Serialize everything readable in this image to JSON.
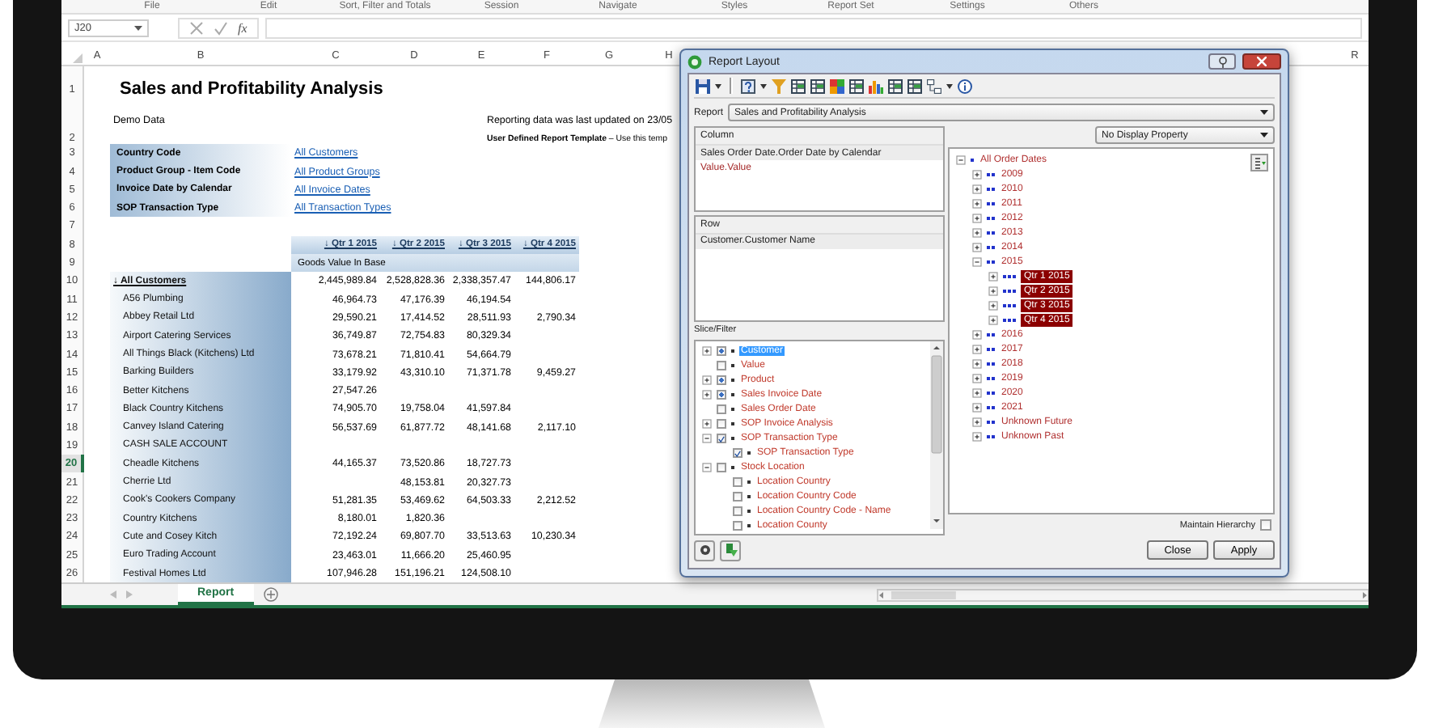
{
  "ribbon": {
    "groups": [
      "File",
      "Edit",
      "Sort, Filter and Totals",
      "Session",
      "Navigate",
      "Styles",
      "Report Set",
      "Settings",
      "Others"
    ]
  },
  "formula_bar": {
    "name_box": "J20",
    "function_label": "fx"
  },
  "sheet": {
    "columns": [
      "A",
      "B",
      "C",
      "D",
      "E",
      "F",
      "G",
      "H",
      "R"
    ],
    "row_headers": [
      {
        "label": "1",
        "selected": false
      },
      {
        "label": "2",
        "selected": false
      },
      {
        "label": "3",
        "selected": false
      },
      {
        "label": "4",
        "selected": false
      },
      {
        "label": "5",
        "selected": false
      },
      {
        "label": "6",
        "selected": false
      },
      {
        "label": "7",
        "selected": false
      },
      {
        "label": "8",
        "selected": false
      },
      {
        "label": "9",
        "selected": false
      },
      {
        "label": "10",
        "selected": false
      },
      {
        "label": "11",
        "selected": false
      },
      {
        "label": "12",
        "selected": false
      },
      {
        "label": "13",
        "selected": false
      },
      {
        "label": "14",
        "selected": false
      },
      {
        "label": "15",
        "selected": false
      },
      {
        "label": "16",
        "selected": false
      },
      {
        "label": "17",
        "selected": false
      },
      {
        "label": "18",
        "selected": false
      },
      {
        "label": "19",
        "selected": false
      },
      {
        "label": "20",
        "selected": true
      },
      {
        "label": "21",
        "selected": false
      },
      {
        "label": "22",
        "selected": false
      },
      {
        "label": "23",
        "selected": false
      },
      {
        "label": "24",
        "selected": false
      },
      {
        "label": "25",
        "selected": false
      },
      {
        "label": "26",
        "selected": false
      }
    ],
    "title": "Sales and Profitability Analysis",
    "subtitle": "Demo Data",
    "update_note": "Reporting data was last updated on 23/05",
    "template_note": "**User Defined Report Template** – Use this temp",
    "filters": [
      {
        "label": "Country Code",
        "link": "All Customers"
      },
      {
        "label": "Product Group - Item Code",
        "link": "All Product Groups"
      },
      {
        "label": "Invoice Date by Calendar",
        "link": "All Invoice Dates"
      },
      {
        "label": "SOP Transaction Type",
        "link": "All Transaction Types"
      }
    ],
    "periods": [
      "↓ Qtr 1 2015",
      "↓ Qtr 2 2015",
      "↓ Qtr 3 2015",
      "↓ Qtr 4 2015"
    ],
    "measure": "Goods Value In Base",
    "total": {
      "label": "↓ All Customers",
      "q1": "2,445,989.84",
      "q2": "2,528,828.36",
      "q3": "2,338,357.47",
      "q4": "144,806.17"
    },
    "customers": [
      {
        "name": "A56 Plumbing",
        "q1": "46,964.73",
        "q2": "47,176.39",
        "q3": "46,194.54"
      },
      {
        "name": "Abbey Retail Ltd",
        "q1": "29,590.21",
        "q2": "17,414.52",
        "q3": "28,511.93",
        "q4": "2,790.34"
      },
      {
        "name": "Airport Catering Services",
        "q1": "36,749.87",
        "q2": "72,754.83",
        "q3": "80,329.34"
      },
      {
        "name": "All Things Black (Kitchens) Ltd",
        "q1": "73,678.21",
        "q2": "71,810.41",
        "q3": "54,664.79"
      },
      {
        "name": "Barking Builders",
        "q1": "33,179.92",
        "q2": "43,310.10",
        "q3": "71,371.78",
        "q4": "9,459.27"
      },
      {
        "name": "Better Kitchens",
        "q1": "27,547.26"
      },
      {
        "name": "Black Country Kitchens",
        "q1": "74,905.70",
        "q2": "19,758.04",
        "q3": "41,597.84"
      },
      {
        "name": "Canvey Island Catering",
        "q1": "56,537.69",
        "q2": "61,877.72",
        "q3": "48,141.68",
        "q4": "2,117.10"
      },
      {
        "name": "CASH SALE ACCOUNT"
      },
      {
        "name": "Cheadle Kitchens",
        "q1": "44,165.37",
        "q2": "73,520.86",
        "q3": "18,727.73"
      },
      {
        "name": "Cherrie Ltd",
        "q2": "48,153.81",
        "q3": "20,327.73"
      },
      {
        "name": "Cook's Cookers Company",
        "q1": "51,281.35",
        "q2": "53,469.62",
        "q3": "64,503.33",
        "q4": "2,212.52"
      },
      {
        "name": "Country Kitchens",
        "q1": "8,180.01",
        "q2": "1,820.36"
      },
      {
        "name": "Cute and Cosey Kitch",
        "q1": "72,192.24",
        "q2": "69,807.70",
        "q3": "33,513.63",
        "q4": "10,230.34"
      },
      {
        "name": "Euro Trading Account",
        "q1": "23,463.01",
        "q2": "11,666.20",
        "q3": "25,460.95"
      },
      {
        "name": "Festival Homes Ltd",
        "q1": "107,946.28",
        "q2": "151,196.21",
        "q3": "124,508.10"
      }
    ]
  },
  "sheet_tabs": [
    {
      "label": "Report",
      "selected": true
    }
  ],
  "dialog": {
    "title": "Report Layout",
    "report_label": "Report",
    "report_value": "Sales and Profitability Analysis",
    "column_panel": {
      "title": "Column",
      "items": [
        {
          "label": "Sales Order Date.Order Date by Calendar",
          "kind": "dimension"
        },
        {
          "label": "Value.Value",
          "kind": "measure"
        }
      ]
    },
    "row_panel": {
      "title": "Row",
      "items": [
        {
          "label": "Customer.Customer Name",
          "kind": "dimension"
        }
      ]
    },
    "slice_title": "Slice/Filter",
    "slice_items": [
      {
        "label": "Customer",
        "expanded": false,
        "checked": false,
        "partial": true,
        "selected": true
      },
      {
        "label": "Value",
        "checked": false,
        "partial": false,
        "selected": false
      },
      {
        "label": "Product",
        "expanded": false,
        "checked": false,
        "partial": true,
        "selected": false
      },
      {
        "label": "Sales Invoice Date",
        "expanded": false,
        "checked": false,
        "partial": true,
        "selected": false
      },
      {
        "label": "Sales Order Date",
        "checked": false,
        "partial": false,
        "selected": false
      },
      {
        "label": "SOP Invoice Analysis",
        "expanded": false,
        "checked": false,
        "partial": false,
        "selected": false
      },
      {
        "label": "SOP Transaction Type",
        "expanded": true,
        "checked": true,
        "partial": false,
        "selected": false,
        "children": [
          {
            "label": "SOP Transaction Type",
            "checked": true,
            "partial": false,
            "selected": false
          }
        ]
      },
      {
        "label": "Stock Location",
        "expanded": true,
        "checked": false,
        "partial": false,
        "selected": false,
        "children": [
          {
            "label": "Location Country",
            "checked": false,
            "partial": false,
            "selected": false
          },
          {
            "label": "Location Country Code",
            "checked": false,
            "partial": false,
            "selected": false
          },
          {
            "label": "Location Country Code - Name",
            "checked": false,
            "partial": false,
            "selected": false
          },
          {
            "label": "Location County",
            "checked": false,
            "partial": false,
            "selected": false
          }
        ]
      }
    ],
    "display_property": "No Display Property",
    "date_tree": [
      {
        "label": "All Order Dates",
        "expanded": true,
        "selected": false,
        "children": [
          {
            "label": "2009",
            "expanded": false,
            "selected": false
          },
          {
            "label": "2010",
            "expanded": false,
            "selected": false
          },
          {
            "label": "2011",
            "expanded": false,
            "selected": false
          },
          {
            "label": "2012",
            "expanded": false,
            "selected": false
          },
          {
            "label": "2013",
            "expanded": false,
            "selected": false
          },
          {
            "label": "2014",
            "expanded": false,
            "selected": false
          },
          {
            "label": "2015",
            "expanded": true,
            "selected": false,
            "children": [
              {
                "label": "Qtr 1 2015",
                "expanded": false,
                "selected": true
              },
              {
                "label": "Qtr 2 2015",
                "expanded": false,
                "selected": true
              },
              {
                "label": "Qtr 3 2015",
                "expanded": false,
                "selected": true
              },
              {
                "label": "Qtr 4 2015",
                "expanded": false,
                "selected": true
              }
            ]
          },
          {
            "label": "2016",
            "expanded": false,
            "selected": false
          },
          {
            "label": "2017",
            "expanded": false,
            "selected": false
          },
          {
            "label": "2018",
            "expanded": false,
            "selected": false
          },
          {
            "label": "2019",
            "expanded": false,
            "selected": false
          },
          {
            "label": "2020",
            "expanded": false,
            "selected": false
          },
          {
            "label": "2021",
            "expanded": false,
            "selected": false
          },
          {
            "label": "Unknown Future",
            "expanded": false,
            "selected": false
          },
          {
            "label": "Unknown Past",
            "expanded": false,
            "selected": false
          }
        ]
      }
    ],
    "maintain_hierarchy": {
      "label": "Maintain Hierarchy",
      "checked": false
    },
    "buttons": [
      "Close",
      "Apply"
    ]
  }
}
